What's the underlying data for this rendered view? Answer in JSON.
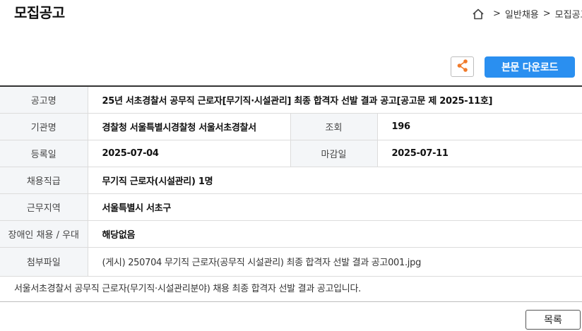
{
  "page": {
    "title": "모집공고"
  },
  "breadcrumb": {
    "items": [
      "일반채용",
      "모집공고"
    ]
  },
  "actions": {
    "download_label": "본문 다운로드",
    "list_label": "목록"
  },
  "info": {
    "rows": [
      {
        "label": "공고명",
        "value": "25년 서초경찰서 공무직 근로자[무기직·시설관리] 최종 합격자 선발 결과 공고[공고문 제 2025-11호]"
      },
      {
        "label": "기관명",
        "value": "경찰청 서울특별시경찰청 서울서초경찰서",
        "label2": "조회",
        "value2": "196"
      },
      {
        "label": "등록일",
        "value": "2025-07-04",
        "label2": "마감일",
        "value2": "2025-07-11"
      },
      {
        "label": "채용직급",
        "value": "무기직 근로자(시설관리) 1명"
      },
      {
        "label": "근무지역",
        "value": "서울특별시 서초구"
      },
      {
        "label": "장애인 채용 / 우대",
        "value": "해당없음"
      },
      {
        "label": "첨부파일",
        "value": "(게시) 250704 무기직 근로자(공무직 시설관리) 최종 합격자 선발 결과 공고001.jpg"
      }
    ]
  },
  "description": "서울서초경찰서 공무직 근로자(무기직·시설관리분야) 채용  최종 합격자 선발 결과 공고입니다."
}
